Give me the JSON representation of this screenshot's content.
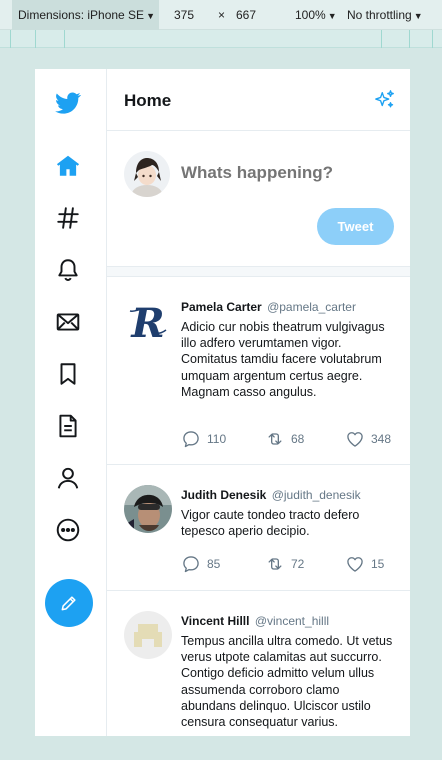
{
  "devtools": {
    "device_label": "Dimensions: iPhone SE",
    "width": "375",
    "times": "×",
    "height": "667",
    "zoom": "100%",
    "throttle": "No throttling"
  },
  "header": {
    "title": "Home"
  },
  "composer": {
    "placeholder": "Whats happening?",
    "tweet_label": "Tweet"
  },
  "colors": {
    "accent": "#1da1f2",
    "tweet_button_disabled": "#8dcff9",
    "text_secondary": "#657786"
  },
  "nav": [
    "twitter-logo-icon",
    "home-icon",
    "hashtag-icon",
    "bell-icon",
    "mail-icon",
    "bookmark-icon",
    "document-icon",
    "user-icon",
    "more-icon",
    "compose-icon"
  ],
  "tweets": [
    {
      "name": "Pamela Carter",
      "handle": "@pamela_carter",
      "text": "Adicio cur nobis theatrum vulgivagus illo adfero verumtamen vigor. Comitatus tamdiu facere volutabrum umquam argentum certus aegre. Magnam casso angulus.",
      "replies": "110",
      "retweets": "68",
      "likes": "348"
    },
    {
      "name": "Judith Denesik",
      "handle": "@judith_denesik",
      "text": "Vigor caute tondeo tracto defero tepesco aperio decipio.",
      "replies": "85",
      "retweets": "72",
      "likes": "15"
    },
    {
      "name": "Vincent Hilll",
      "handle": "@vincent_hilll",
      "text": "Tempus ancilla ultra comedo. Ut vetus verus utpote calamitas aut succurro. Contigo deficio admitto velum ullus assumenda corroboro clamo abundans delinquo. Ulciscor ustilo censura consequatur varius."
    }
  ]
}
